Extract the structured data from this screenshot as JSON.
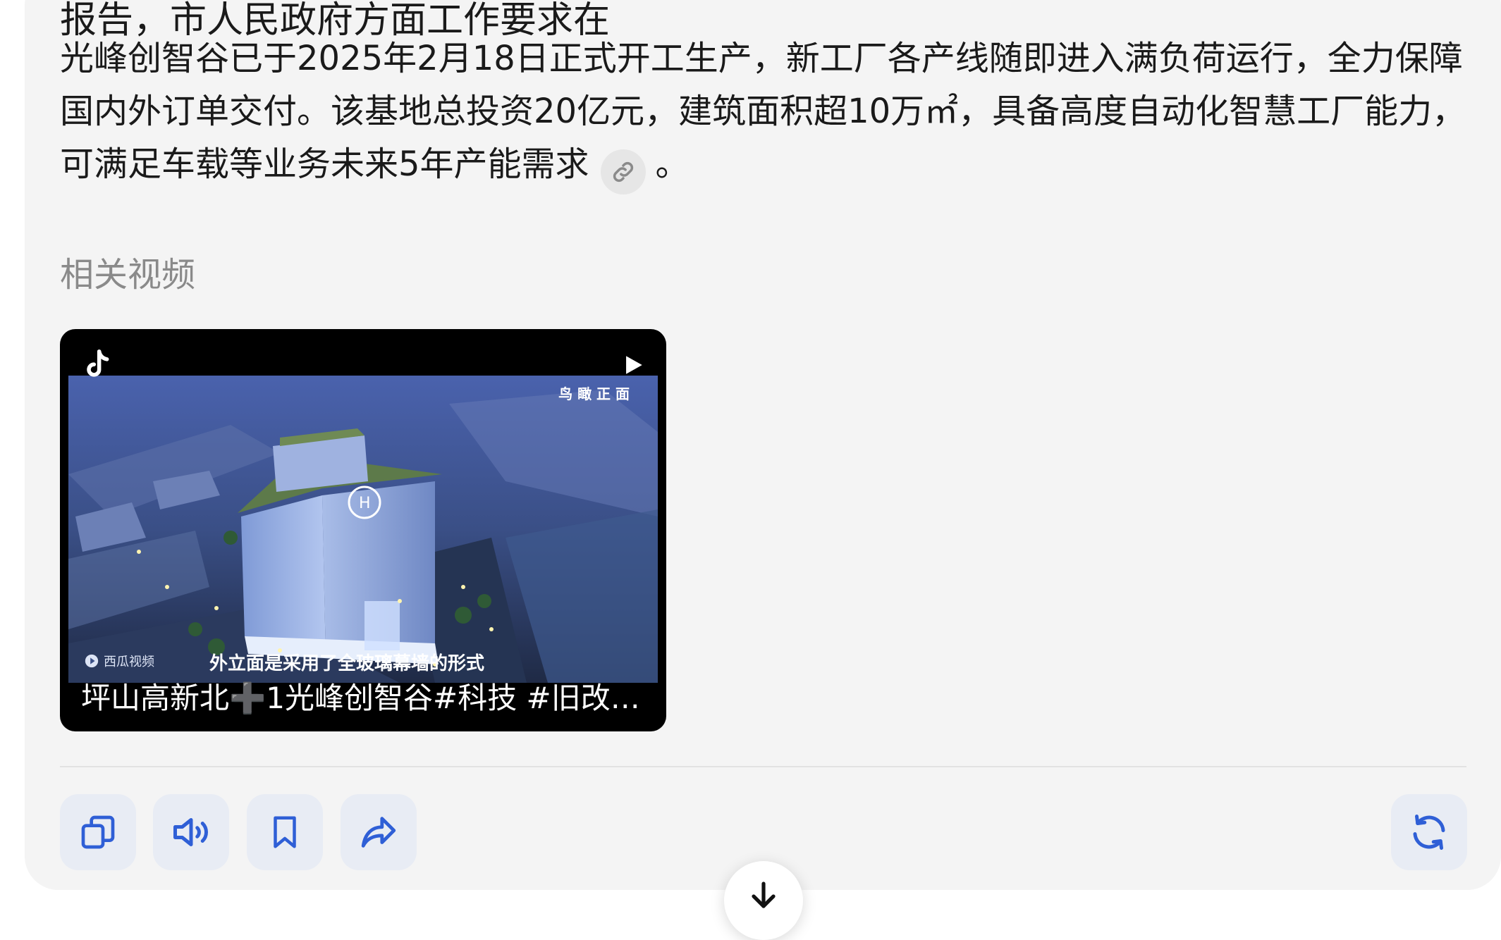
{
  "answer": {
    "cut_off_line": "报告，市人民政府方面工作要求在",
    "paragraph": "光峰创智谷已于2025年2月18日正式开工生产，新工厂各产线随即进入满负荷运行，全力保障国内外订单交付。该基地总投资20亿元，建筑面积超10万㎡，具备高度自动化智慧工厂能力，可满足车载等业务未来5年产能需求",
    "after_citation": "。",
    "citation_icon": "link-icon"
  },
  "related_videos": {
    "section_title": "相关视频",
    "items": [
      {
        "title": "坪山高新北➕1光峰创智谷#科技 #旧改 #…",
        "overlay_top_right": "鸟 瞰 正 面",
        "subtitle": "外立面是采用了全玻璃幕墙的形式",
        "watermark": "西瓜视频",
        "platform_icon": "tiktok-icon",
        "play_icon": "play-icon"
      }
    ]
  },
  "actions": {
    "buttons": [
      {
        "name": "copy",
        "icon": "copy-icon"
      },
      {
        "name": "read-aloud",
        "icon": "speaker-icon"
      },
      {
        "name": "bookmark",
        "icon": "bookmark-icon"
      },
      {
        "name": "share",
        "icon": "share-icon"
      },
      {
        "name": "regenerate",
        "icon": "refresh-icon"
      }
    ],
    "scroll_down_icon": "arrow-down-icon"
  },
  "colors": {
    "card_bg": "#f4f4f4",
    "accent": "#2f5fd6",
    "button_bg": "#e8ecf4",
    "muted_text": "#8a8a8a"
  }
}
